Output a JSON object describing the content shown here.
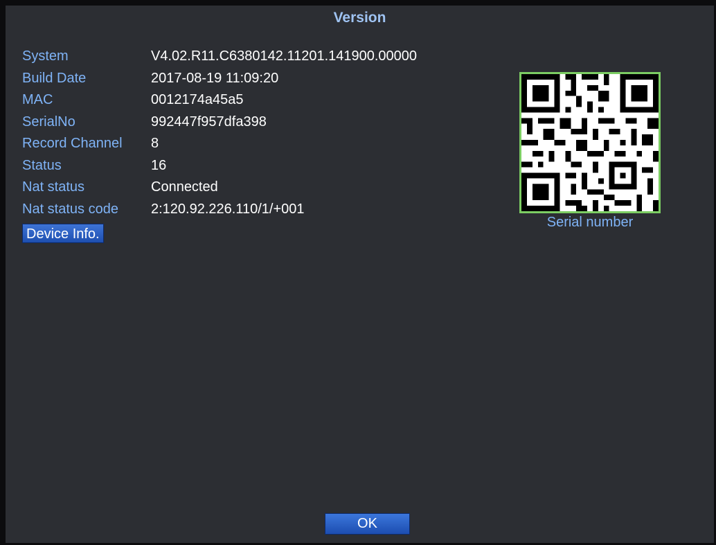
{
  "window": {
    "title": "Version"
  },
  "info": [
    {
      "label": "System",
      "value": "V4.02.R11.C6380142.11201.141900.00000"
    },
    {
      "label": "Build Date",
      "value": "2017-08-19 11:09:20"
    },
    {
      "label": "MAC",
      "value": "0012174a45a5"
    },
    {
      "label": "SerialNo",
      "value": "992447f957dfa398"
    },
    {
      "label": "Record Channel",
      "value": "8"
    },
    {
      "label": "Status",
      "value": "16"
    },
    {
      "label": "Nat status",
      "value": "Connected"
    },
    {
      "label": "Nat status code",
      "value": "2:120.92.226.110/1/+001"
    }
  ],
  "buttons": {
    "device_info": "Device Info.",
    "ok": "OK"
  },
  "qr": {
    "caption": "Serial number"
  },
  "colors": {
    "background": "#2c2e33",
    "label": "#7fb3f6",
    "value": "#ffffff",
    "button": "#1e4fb0",
    "qr_border": "#7ccd63"
  }
}
